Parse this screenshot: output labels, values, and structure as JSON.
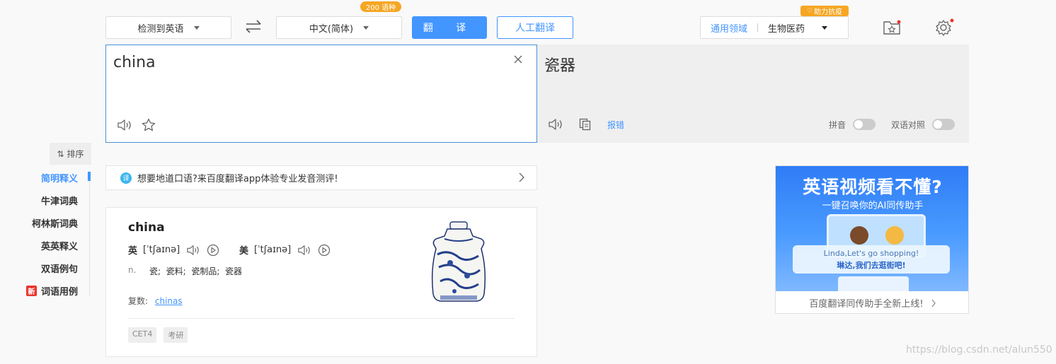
{
  "top_bar": {
    "source_lang": "检测到英语",
    "target_lang": "中文(简体)",
    "lang_count_badge": "200 语种",
    "translate_button": "翻 译",
    "human_translate_button": "人工翻译",
    "domain_label": "通用领域",
    "domain_value": "生物医药",
    "domain_badge": "助力抗疫"
  },
  "source": {
    "text": "china"
  },
  "target": {
    "text": "瓷器",
    "report_link": "报错",
    "pinyin_label": "拼音",
    "bilingual_label": "双语对照",
    "pinyin_on": false,
    "bilingual_on": false
  },
  "sidebar": {
    "sort_label": "排序",
    "items": [
      {
        "label": "简明释义",
        "active": true
      },
      {
        "label": "牛津词典",
        "active": false
      },
      {
        "label": "柯林斯词典",
        "active": false
      },
      {
        "label": "英英释义",
        "active": false
      },
      {
        "label": "双语例句",
        "active": false
      },
      {
        "label": "词语用例",
        "active": false,
        "badge": "新"
      }
    ]
  },
  "promo_banner": {
    "text": "想要地道口语?来百度翻译app体验专业发音测评!"
  },
  "dictionary": {
    "word": "china",
    "uk_label": "英",
    "uk_phonetic": "[ˈtʃaɪnə]",
    "us_label": "美",
    "us_phonetic": "[ˈtʃaɪnə]",
    "pos": "n.",
    "meanings": "瓷;  瓷料;  瓷制品;  瓷器",
    "plural_label": "复数:",
    "plural_value": "chinas",
    "tags": [
      "CET4",
      "考研"
    ]
  },
  "ad": {
    "headline": "英语视频看不懂?",
    "subhead": "一键召唤你的AI同传助手",
    "bubble_en": "Linda,Let's go shopping!",
    "bubble_cn": "琳达,我们去逛街吧!",
    "caption": "百度翻译同传助手全新上线!"
  },
  "watermark": "https://blog.csdn.net/alun550",
  "colors": {
    "accent": "#4395ff",
    "badge_orange": "#f6a623",
    "new_badge_red": "#e9362f"
  }
}
